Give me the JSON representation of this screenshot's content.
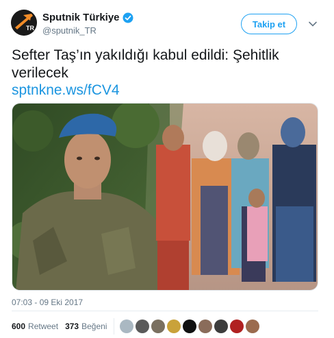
{
  "account": {
    "display_name": "Sputnik Türkiye",
    "handle": "@sputnik_TR",
    "avatar_logo_text": "TR",
    "verified": true
  },
  "follow_button": {
    "label": "Takip et"
  },
  "menu": {
    "icon": "chevron-down-icon"
  },
  "tweet": {
    "text": "Sefter Taş’ın yakıldığı kabul edildi: Şehitlik verilecek",
    "link": "sptnkne.ws/fCV4"
  },
  "timestamp": "07:03 - 09 Eki 2017",
  "stats": {
    "retweets_count": "600",
    "retweets_label": "Retweet",
    "likes_count": "373",
    "likes_label": "Beğeni"
  },
  "likers": [
    {
      "name": "liker-avatar-1",
      "color": "#aab8c2"
    },
    {
      "name": "liker-avatar-2",
      "color": "#5a5a5a"
    },
    {
      "name": "liker-avatar-3",
      "color": "#7a7060"
    },
    {
      "name": "liker-avatar-4",
      "color": "#c9a23a"
    },
    {
      "name": "liker-avatar-5",
      "color": "#111111"
    },
    {
      "name": "liker-avatar-6",
      "color": "#8a6c5a"
    },
    {
      "name": "liker-avatar-7",
      "color": "#3d3d3d"
    },
    {
      "name": "liker-avatar-8",
      "color": "#b02020"
    },
    {
      "name": "liker-avatar-9",
      "color": "#9b6b4e"
    }
  ],
  "colors": {
    "accent": "#1da1f2",
    "link": "#1b95e0",
    "secondary_text": "#657786",
    "brand_orange": "#f28c28"
  }
}
